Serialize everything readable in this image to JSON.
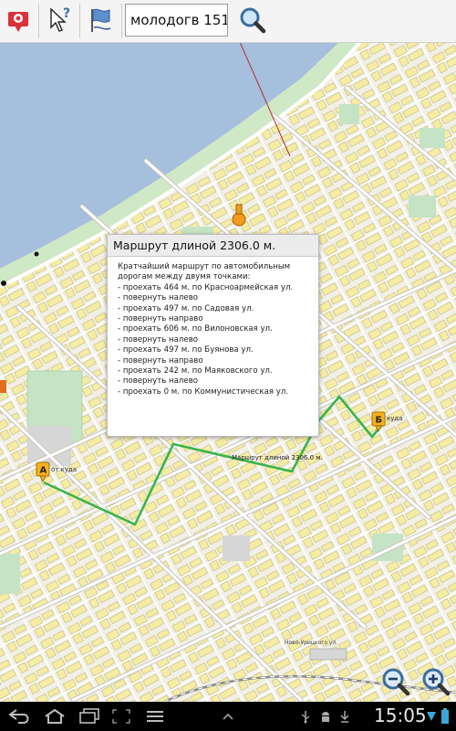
{
  "toolbar": {
    "search_value": "молодогв 151",
    "icons": [
      "map-pin-icon",
      "help-cursor-icon",
      "flag-icon",
      "search-icon"
    ]
  },
  "popup": {
    "title": "Маршрут длиной 2306.0 м.",
    "intro_line1": "Кратчайший маршрут по автомобильным",
    "intro_line2": "дорогам между двумя точками:",
    "steps": [
      "- проехать 464 м. по Красноармейская ул.",
      "- повернуть налево",
      "- проехать 497 м. по Садовая ул.",
      "- повернуть направо",
      "- проехать 606 м. по Вилоновская ул.",
      "- повернуть налево",
      "- проехать 497 м. по Буянова ул.",
      "- повернуть направо",
      "- проехать 242 м. по Маяковского ул.",
      "- повернуть налево",
      "- проехать 0 м. по Коммунистическая ул."
    ]
  },
  "map": {
    "marker_a_letter": "А",
    "marker_a_label": "от куда",
    "marker_b_letter": "Б",
    "marker_b_label": "куда",
    "route_label": "Маршрут длиной 2306.0 м.",
    "street_label": "Ново-Урицкого ул."
  },
  "system_bar": {
    "time": "15:05",
    "icons": [
      "back-icon",
      "home-icon",
      "recent-apps-icon",
      "screenshot-icon",
      "menu-icon",
      "chevron-up-icon",
      "usb-icon",
      "android-icon",
      "download-icon",
      "signal-icon",
      "battery-icon"
    ]
  },
  "colors": {
    "water": "#a5bfdd",
    "road": "#ffffff",
    "land": "#f2efe6",
    "building": "#f5eda4",
    "park": "#c5e4c5",
    "route": "#39b54a",
    "highway": "#ffd080"
  }
}
